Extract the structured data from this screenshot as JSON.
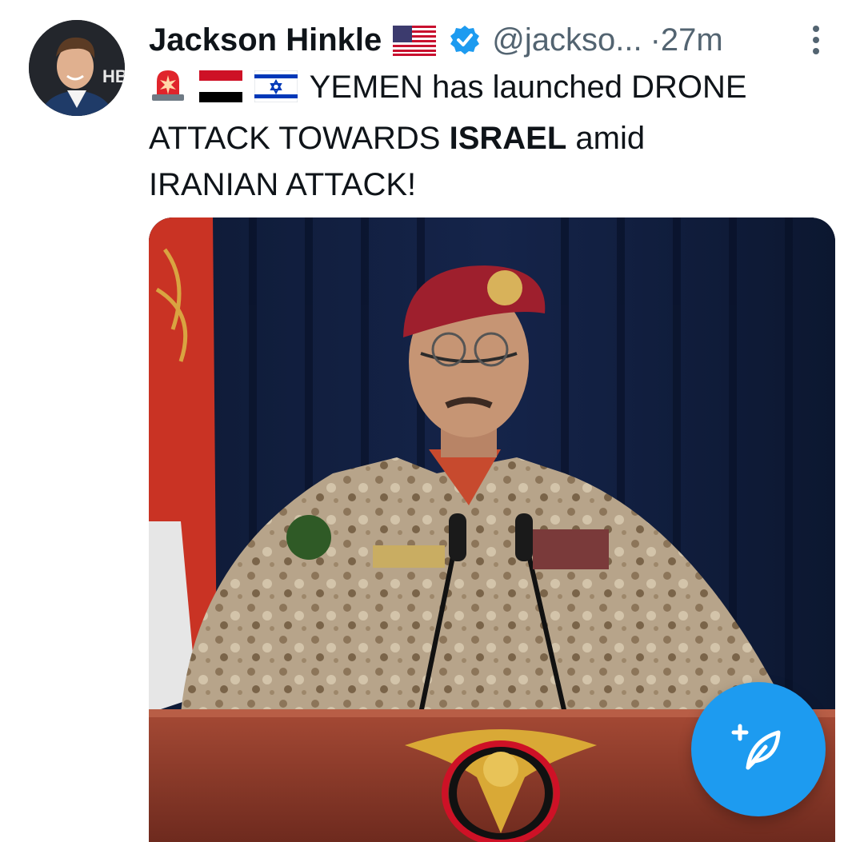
{
  "tweet": {
    "author_name": "Jackson Hinkle",
    "handle": "@jackso...",
    "separator": "·",
    "time": "27m",
    "text_line1": "YEMEN has launched DRONE",
    "text_line2_a": "ATTACK TOWARDS ",
    "text_line2_bold": "ISRAEL",
    "text_line2_b": " amid",
    "text_line3": "IRANIAN ATTACK!",
    "emojis": [
      "police-light-icon",
      "yemen-flag-icon",
      "israel-flag-icon"
    ],
    "author_flag": "us-flag-icon",
    "verified": true
  },
  "colors": {
    "accent": "#1d9bf0",
    "text": "#0f1419",
    "muted": "#536471"
  },
  "compose_button": {
    "icon": "compose-feather-icon"
  }
}
